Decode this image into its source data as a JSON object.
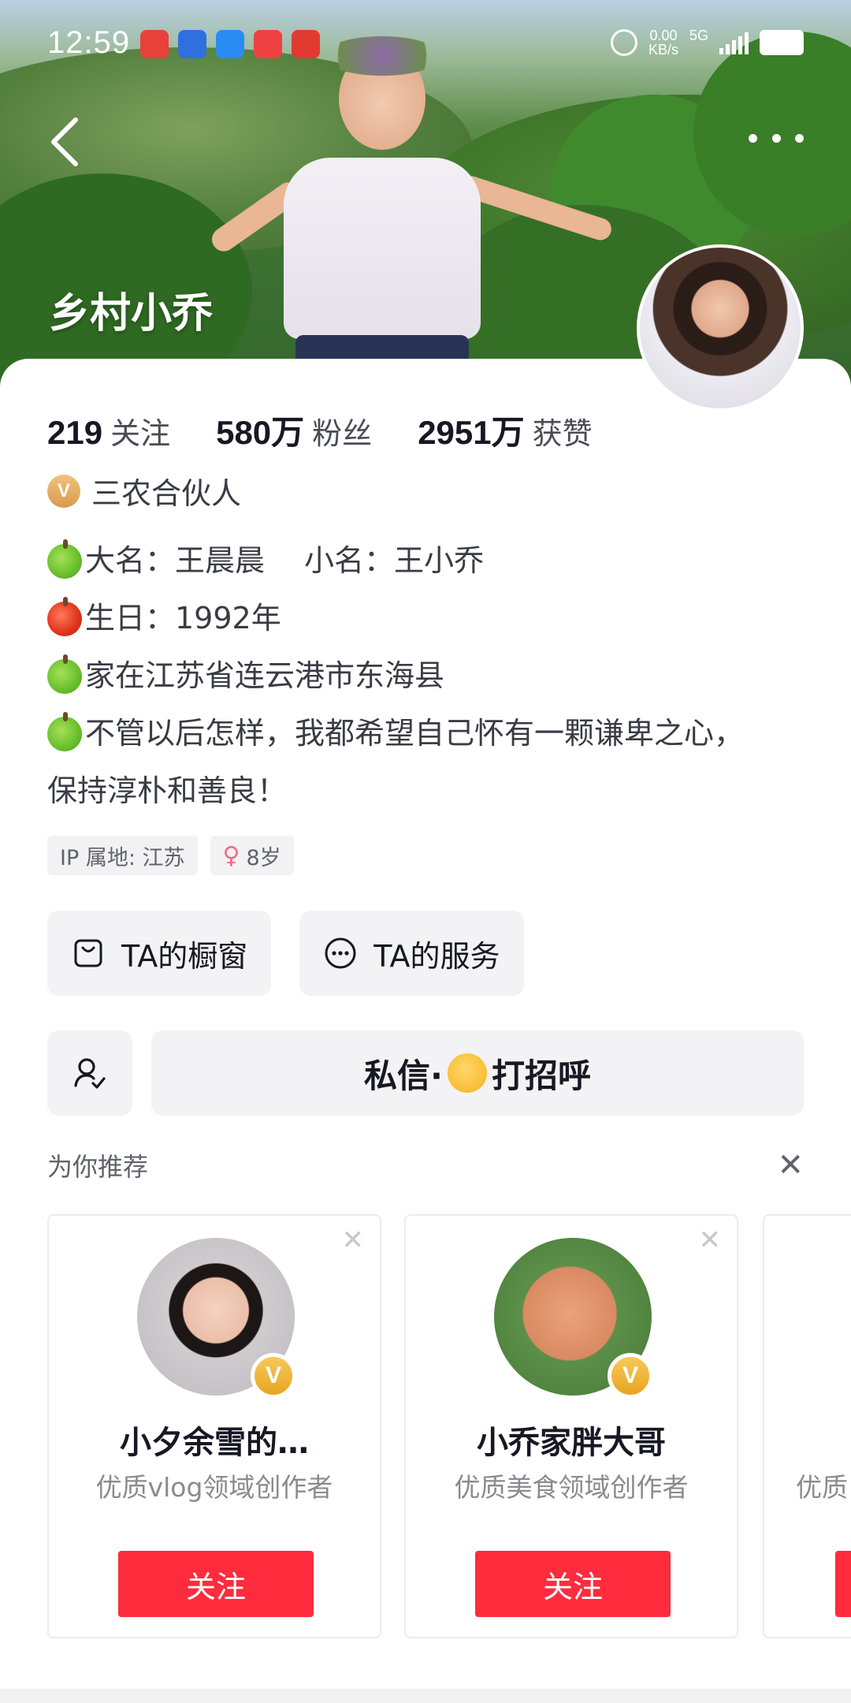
{
  "status_bar": {
    "time": "12:59",
    "net_speed_value": "0.00",
    "net_speed_unit": "KB/s",
    "network": "5G"
  },
  "profile": {
    "name": "乡村小乔",
    "stats": [
      {
        "num": "219",
        "label": "关注"
      },
      {
        "num": "580万",
        "label": "粉丝"
      },
      {
        "num": "2951万",
        "label": "获赞"
      }
    ],
    "verified_badge": "V",
    "verified_title": "三农合伙人",
    "bio": {
      "line1_a": "大名：王晨晨",
      "line1_b": "小名：王小乔",
      "line2": "生日：1992年",
      "line3": "家在江苏省连云港市东海县",
      "line4": "不管以后怎样，我都希望自己怀有一颗谦卑之心，",
      "line5": "保持淳朴和善良！"
    },
    "tags": {
      "ip": "IP 属地: 江苏",
      "gender_symbol": "♀",
      "age": "8岁"
    }
  },
  "actions": {
    "showcase": "TA的橱窗",
    "services": "TA的服务",
    "message": "私信·",
    "greet": "打招呼"
  },
  "recommend": {
    "title": "为你推荐",
    "close": "✕",
    "cards": [
      {
        "name": "小夕余雪的…",
        "desc": "优质vlog领域创作者",
        "badge": "V",
        "follow": "关注",
        "close": "✕"
      },
      {
        "name": "小乔家胖大哥",
        "desc": "优质美食领域创作者",
        "badge": "V",
        "follow": "关注",
        "close": "✕"
      },
      {
        "name": "",
        "desc": "优质",
        "badge": "",
        "follow": "",
        "close": ""
      }
    ]
  },
  "colors": {
    "accent_red": "#fe2c3d",
    "verified_gold": "#e8a51f"
  },
  "icons": {
    "back": "chevron-left-icon",
    "more": "more-horizontal-icon",
    "showcase": "shopping-bag-icon",
    "services": "ellipsis-circle-icon",
    "follow_user": "user-add-icon"
  }
}
